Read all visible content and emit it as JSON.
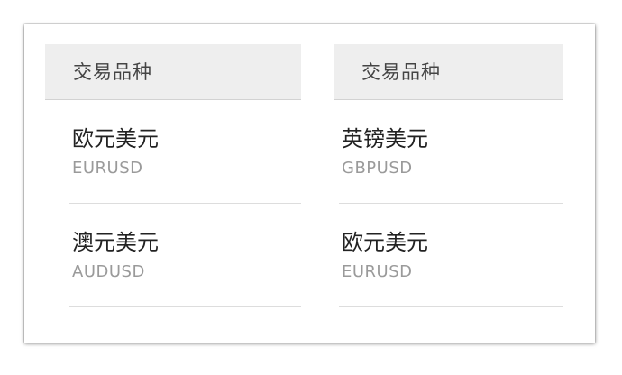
{
  "columns": [
    {
      "header": "交易品种",
      "items": [
        {
          "name": "欧元美元",
          "code": "EURUSD"
        },
        {
          "name": "澳元美元",
          "code": "AUDUSD"
        }
      ]
    },
    {
      "header": "交易品种",
      "items": [
        {
          "name": "英镑美元",
          "code": "GBPUSD"
        },
        {
          "name": "欧元美元",
          "code": "EURUSD"
        }
      ]
    }
  ]
}
